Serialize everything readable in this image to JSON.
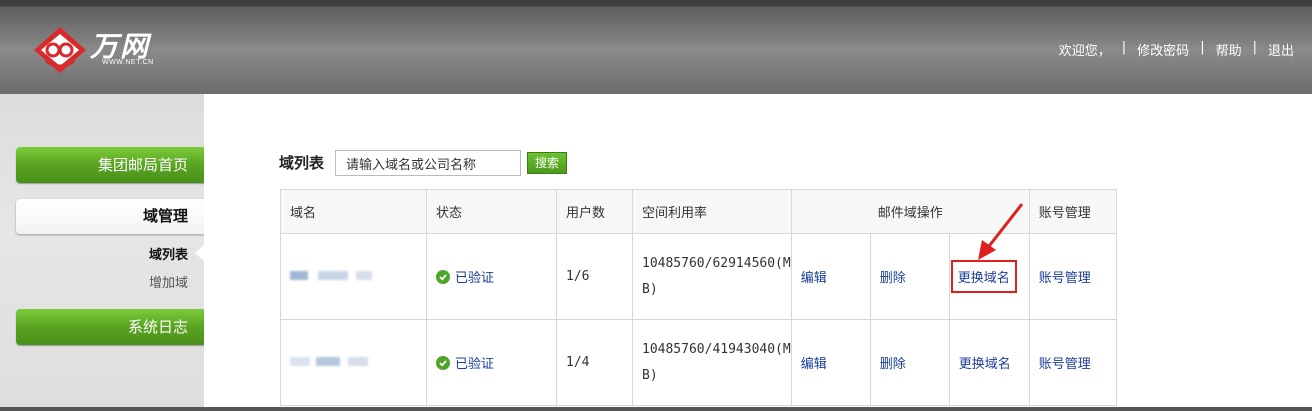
{
  "header": {
    "brand": "万网",
    "brand_sub": "WWW.NET.CN",
    "nav": {
      "welcome": "欢迎您，",
      "change_password": "修改密码",
      "help": "帮助",
      "logout": "退出",
      "sep": "|"
    }
  },
  "sidebar": {
    "home": "集团邮局首页",
    "domain_manage": "域管理",
    "sub_domain_list": "域列表",
    "sub_add_domain": "增加域",
    "system_log": "系统日志"
  },
  "main": {
    "title": "域列表",
    "search_placeholder": "请输入域名或公司名称",
    "search_button": "搜索",
    "columns": {
      "domain": "域名",
      "status": "状态",
      "users": "用户数",
      "space": "空间利用率",
      "mail_ops": "邮件域操作",
      "account": "账号管理"
    },
    "rows": [
      {
        "status": "已验证",
        "users": "1/6",
        "space_line1": "10485760/62914560(M",
        "space_line2": "B)",
        "edit": "编辑",
        "delete": "删除",
        "change_domain": "更换域名",
        "account": "账号管理"
      },
      {
        "status": "已验证",
        "users": "1/4",
        "space_line1": "10485760/41943040(M",
        "space_line2": "B)",
        "edit": "编辑",
        "delete": "删除",
        "change_domain": "更换域名",
        "account": "账号管理"
      }
    ]
  },
  "colors": {
    "accent_green": "#5aa321",
    "link_blue": "#1a3d9c",
    "highlight_red": "#e02020",
    "header_gray": "#6c6c6c"
  }
}
